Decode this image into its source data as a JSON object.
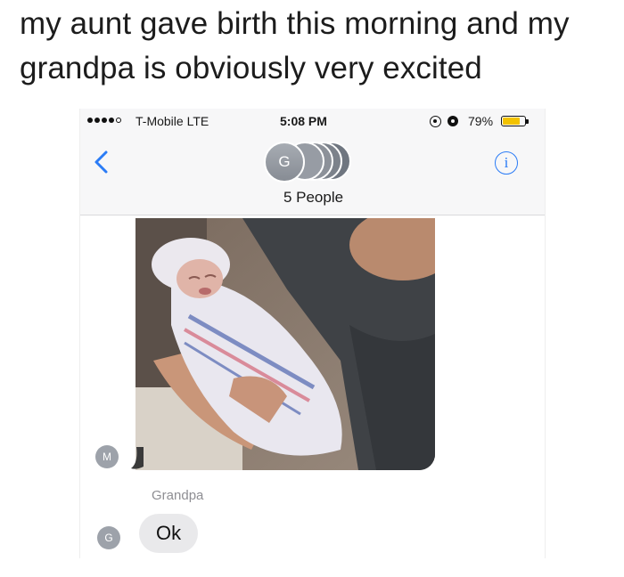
{
  "caption": "my aunt gave birth this morning and my grandpa is obviously very excited",
  "status_bar": {
    "carrier": "T-Mobile  LTE",
    "time": "5:08 PM",
    "battery_percent_label": "79%",
    "battery_level": 0.79,
    "battery_color": "#f2c200"
  },
  "header": {
    "back_icon": "chevron-left-icon",
    "info_icon": "info-icon",
    "info_glyph": "i",
    "group_avatar_initial": "G",
    "people_count_label": "5 People",
    "accent_color": "#2b7cf6"
  },
  "messages": [
    {
      "type": "photo",
      "sender_initial": "M",
      "alt": "newborn baby wrapped in a striped hospital blanket held by a man"
    },
    {
      "type": "text",
      "sender_name": "Grandpa",
      "sender_initial": "G",
      "text": "Ok"
    }
  ]
}
